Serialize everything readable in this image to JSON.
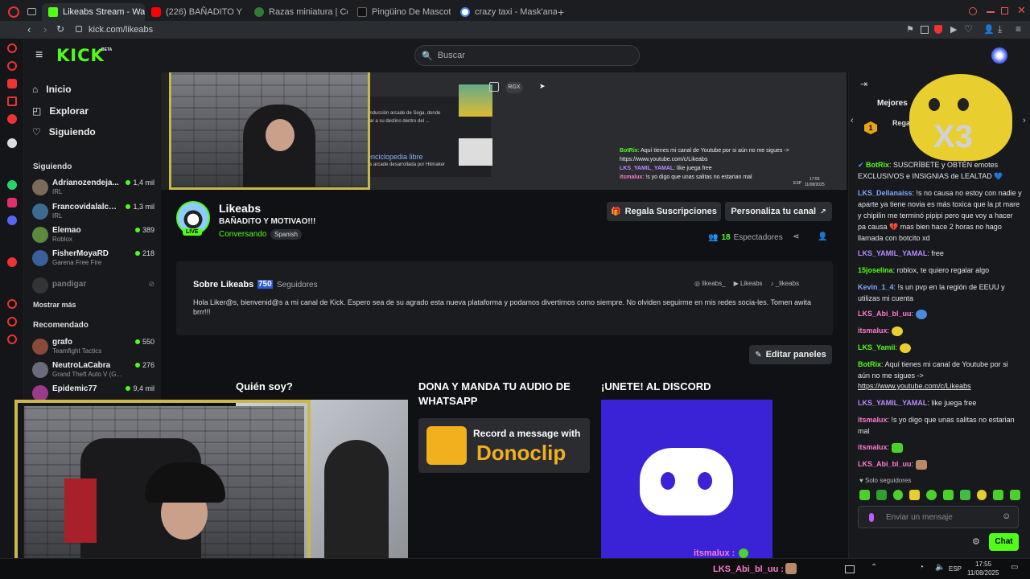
{
  "browser": {
    "tabs": [
      {
        "label": "Likeabs Stream - Watch L",
        "active": true,
        "color": "#53fc18"
      },
      {
        "label": "(226) BAÑADITO Y MOT",
        "active": false,
        "color": "#ff0000"
      },
      {
        "label": "Razas miniatura | Centra",
        "active": false,
        "color": "#2e7d32"
      },
      {
        "label": "Pingüino De Mascota | T",
        "active": false,
        "color": "#111111"
      },
      {
        "label": "crazy taxi - Mask'ana Go",
        "active": false,
        "color": "#4285f4"
      }
    ],
    "url": "kick.com/likeabs"
  },
  "header": {
    "logo": "KICK",
    "logo_sup": "BETA",
    "search_placeholder": "Buscar"
  },
  "sidebar": {
    "nav": [
      {
        "label": "Inicio",
        "icon": "home-icon"
      },
      {
        "label": "Explorar",
        "icon": "compass-icon"
      },
      {
        "label": "Siguiendo",
        "icon": "heart-icon"
      }
    ],
    "following_title": "Siguiendo",
    "following": [
      {
        "name": "Adrianozendeja...",
        "category": "IRL",
        "viewers": "1,4 mil",
        "color": "#7a6a5a"
      },
      {
        "name": "Francovidalalcal...",
        "category": "IRL",
        "viewers": "1,3 mil",
        "color": "#3d6b8f"
      },
      {
        "name": "Elemao",
        "category": "Roblox",
        "viewers": "389",
        "color": "#5a8a3a"
      },
      {
        "name": "FisherMoyaRD",
        "category": "Garena Free Fire",
        "viewers": "218",
        "color": "#3a5f9a"
      }
    ],
    "offline_channel": "pandigar",
    "show_more": "Mostrar más",
    "recommended_title": "Recomendado",
    "recommended": [
      {
        "name": "grafo",
        "category": "Teamfight Tactics",
        "viewers": "550",
        "color": "#8a4a3a"
      },
      {
        "name": "NeutroLaCabra",
        "category": "Grand Theft Auto V (G...",
        "viewers": "276",
        "color": "#6a6a7a"
      },
      {
        "name": "Epidemic77",
        "category": "",
        "viewers": "9,4 mil",
        "color": "#9a3a8a"
      }
    ]
  },
  "player": {
    "overlay_text1": "onducción arcade de Sega, donde",
    "overlay_text2": "gar a su destino dentro del ...",
    "overlay_link": "enciclopedia libre",
    "overlay_text3": "es arcade desarrollada por Hitmaker",
    "chip": "RGX",
    "chat_lines": [
      {
        "user": "BotRix",
        "text": ": Aquí tienes mi canal de Youtube por si aún no me sigues ->"
      },
      {
        "user": "",
        "text": "https://www.youtube.com/c/Likeabs"
      },
      {
        "user": "LKS_YAMIL_YAMAL",
        "text": ": like juega free"
      },
      {
        "user": "itsmalux",
        "text": ": !s yo digo que unas salitas no estarian mal"
      }
    ],
    "clock_time": "17:55",
    "clock_date": "11/08/2025",
    "lang": "ESP"
  },
  "channel": {
    "name": "Likeabs",
    "title": "BAÑADITO Y MOTIVAO!!!",
    "category": "Conversando",
    "language": "Spanish",
    "live": "LIVE",
    "gift_button": "Regala Suscripciones",
    "customize_button": "Personaliza tu canal",
    "viewers": "18",
    "viewers_label": "Espectadores"
  },
  "about": {
    "title": "Sobre Likeabs",
    "followers": "750",
    "followers_label": "Seguidores",
    "socials": [
      "likeabs_",
      "Likeabs",
      "_likeabs"
    ],
    "bio": "Hola Liker@s, bienvenid@s a mi canal de Kick. Espero sea de su agrado esta nueva plataforma y podamos divertirnos como siempre. No olviden seguirme en mis redes socia-les. Tomen awita brrr!!!"
  },
  "panels": {
    "edit_button": "Editar paneles",
    "items": [
      {
        "title": "Quién soy?"
      },
      {
        "title": "DONA Y MANDA TU AUDIO DE WHATSAPP",
        "image_text1": "Record a message with",
        "image_text2": "Donoclip"
      },
      {
        "title": "¡UNETE! AL DISCORD"
      }
    ],
    "overlay_user": "itsmalux :"
  },
  "chat": {
    "top_label": "Mejores",
    "gift_label": "Regal",
    "rank": "1",
    "messages": [
      {
        "user": "BotRix",
        "color": "#53fc18",
        "text": ": SUSCRÍBETE y OBTÉN emotes EXCLUSIVOS e INSIGNIAS de LEALTAD 💙"
      },
      {
        "user": "LKS_Dellanaiss",
        "color": "#7fa8ff",
        "text": ": !s no causa no estoy con nadie y aparte ya tiene novia es más toxica que la pt mare y chipilin me terminó pipipi pero que voy a hacer pa causa 💔 mas bien hace 2 horas no hago llamada con botcito xd"
      },
      {
        "user": "LKS_YAMIL_YAMAL",
        "color": "#b98cff",
        "text": ": free"
      },
      {
        "user": "15joselina",
        "color": "#53fc18",
        "text": ": roblox, te quiero regalar algo"
      },
      {
        "user": "Kevin_1_4",
        "color": "#7fa8ff",
        "text": ": !s un pvp en la región de EEUU y utilizas mi cuenta"
      },
      {
        "user": "LKS_Abi_bl_uu",
        "color": "#ff7bd0",
        "text": ":"
      },
      {
        "user": "itsmalux",
        "color": "#ff7bd0",
        "text": ":"
      },
      {
        "user": "LKS_Yamii",
        "color": "#53fc18",
        "text": ":"
      },
      {
        "user": "BotRix",
        "color": "#53fc18",
        "text": ": Aquí tienes mi canal de Youtube por si aún no me sigues ->"
      },
      {
        "user": "",
        "color": "#ffffff",
        "text": "https://www.youtube.com/c/Likeabs"
      },
      {
        "user": "LKS_YAMIL_YAMAL",
        "color": "#b98cff",
        "text": ": like juega free"
      },
      {
        "user": "itsmalux",
        "color": "#ff7bd0",
        "text": ": !s yo digo que unas salitas no estarian mal"
      },
      {
        "user": "itsmalux",
        "color": "#ff7bd0",
        "text": ":"
      },
      {
        "user": "LKS_Abi_bl_uu",
        "color": "#ff7bd0",
        "text": ":"
      }
    ],
    "followers_only": "Solo seguidores",
    "input_placeholder": "Enviar un mensaje",
    "send_button": "Chat"
  },
  "overlays": {
    "x3": "X3",
    "bottom_user": "LKS_Abi_bl_uu :"
  },
  "taskbar": {
    "lang": "ESP",
    "time": "17:55",
    "date": "11/08/2025"
  }
}
